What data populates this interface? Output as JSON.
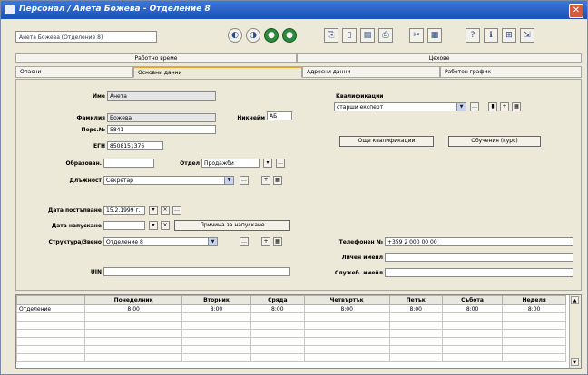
{
  "window": {
    "title": "Персонал / Анета Божева - Отделение 8"
  },
  "toolbar": {
    "combo_value": "Анета Божева (Отделение 8)"
  },
  "section_tabs": [
    "Работно време",
    "Цехове"
  ],
  "tabs": [
    "Опасни",
    "Основни данни",
    "Адресни данни",
    "Работен график"
  ],
  "form": {
    "name_label": "Име",
    "name": "Анета",
    "surname_label": "Фамилия",
    "surname": "Божева",
    "persno_label": "Перс.№",
    "persno": "5841",
    "nickname_label": "Никнейм",
    "nickname": "АБ",
    "egn_label": "ЕГН",
    "egn": "8508151376",
    "education_label": "Образован.",
    "education": "",
    "dept_label": "Отдел",
    "dept": "Продажби",
    "position_label": "Длъжност",
    "position": "Секретар",
    "start_label": "Дата постъпване",
    "start": "15.2.1999 г.",
    "leave_label": "Дата напускане",
    "leave": "",
    "reason_button": "Причина за напускане",
    "station_label": "Структура/Звено",
    "station": "Отделение 8",
    "uin_label": "UIN",
    "uin": "",
    "qual_label": "Квалификации",
    "qual": "старши експерт",
    "qual_button": "Още квалификации",
    "train_button": "Обучения (курс)",
    "phone_label": "Телефонен №",
    "phone": "+359 2 000 00 00",
    "email_label": "Личен имейл",
    "email": "",
    "email2_label": "Служеб. имейл",
    "email2": ""
  },
  "schedule": {
    "headers": [
      "",
      "Понеделник",
      "Вторник",
      "Сряда",
      "Четвъртък",
      "Петък",
      "Събота",
      "Неделя"
    ],
    "rows": [
      [
        "Отделение",
        "8:00",
        "8:00",
        "8:00",
        "8:00",
        "8:00",
        "8:00",
        "8:00"
      ]
    ]
  }
}
